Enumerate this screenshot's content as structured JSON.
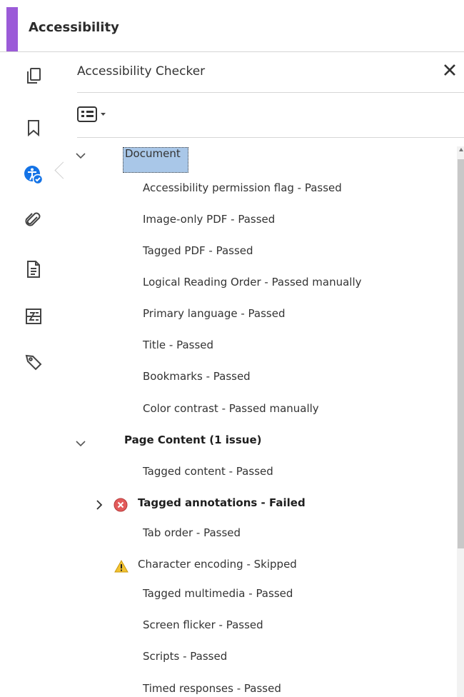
{
  "header": {
    "title": "Accessibility",
    "accent_color": "#9b5bd8"
  },
  "rail": {
    "icons": [
      "pages-icon",
      "bookmark-icon",
      "accessibility-icon",
      "attachment-icon",
      "document-icon",
      "compare-icon",
      "tag-icon"
    ],
    "active": "accessibility-icon",
    "active_color": "#1473e6"
  },
  "panel": {
    "title": "Accessibility Checker",
    "close_icon": "close-icon",
    "options_icon": "list-options-icon"
  },
  "tree": {
    "document": {
      "label": "Document",
      "items": [
        "Accessibility permission flag - Passed",
        "Image-only PDF - Passed",
        "Tagged PDF - Passed",
        "Logical Reading Order - Passed manually",
        "Primary language - Passed",
        "Title - Passed",
        "Bookmarks - Passed",
        "Color contrast - Passed manually"
      ]
    },
    "page_content": {
      "label": "Page Content (1 issue)",
      "items": {
        "tagged_content": "Tagged content - Passed",
        "tagged_annotations": "Tagged annotations - Failed",
        "tab_order": "Tab order - Passed",
        "character_encoding": "Character encoding - Skipped",
        "tagged_multimedia": "Tagged multimedia - Passed",
        "screen_flicker": "Screen flicker - Passed",
        "scripts": "Scripts - Passed",
        "timed_responses": "Timed responses - Passed"
      }
    }
  },
  "status_colors": {
    "failed": "#e35b5b",
    "warning": "#f2c230"
  }
}
